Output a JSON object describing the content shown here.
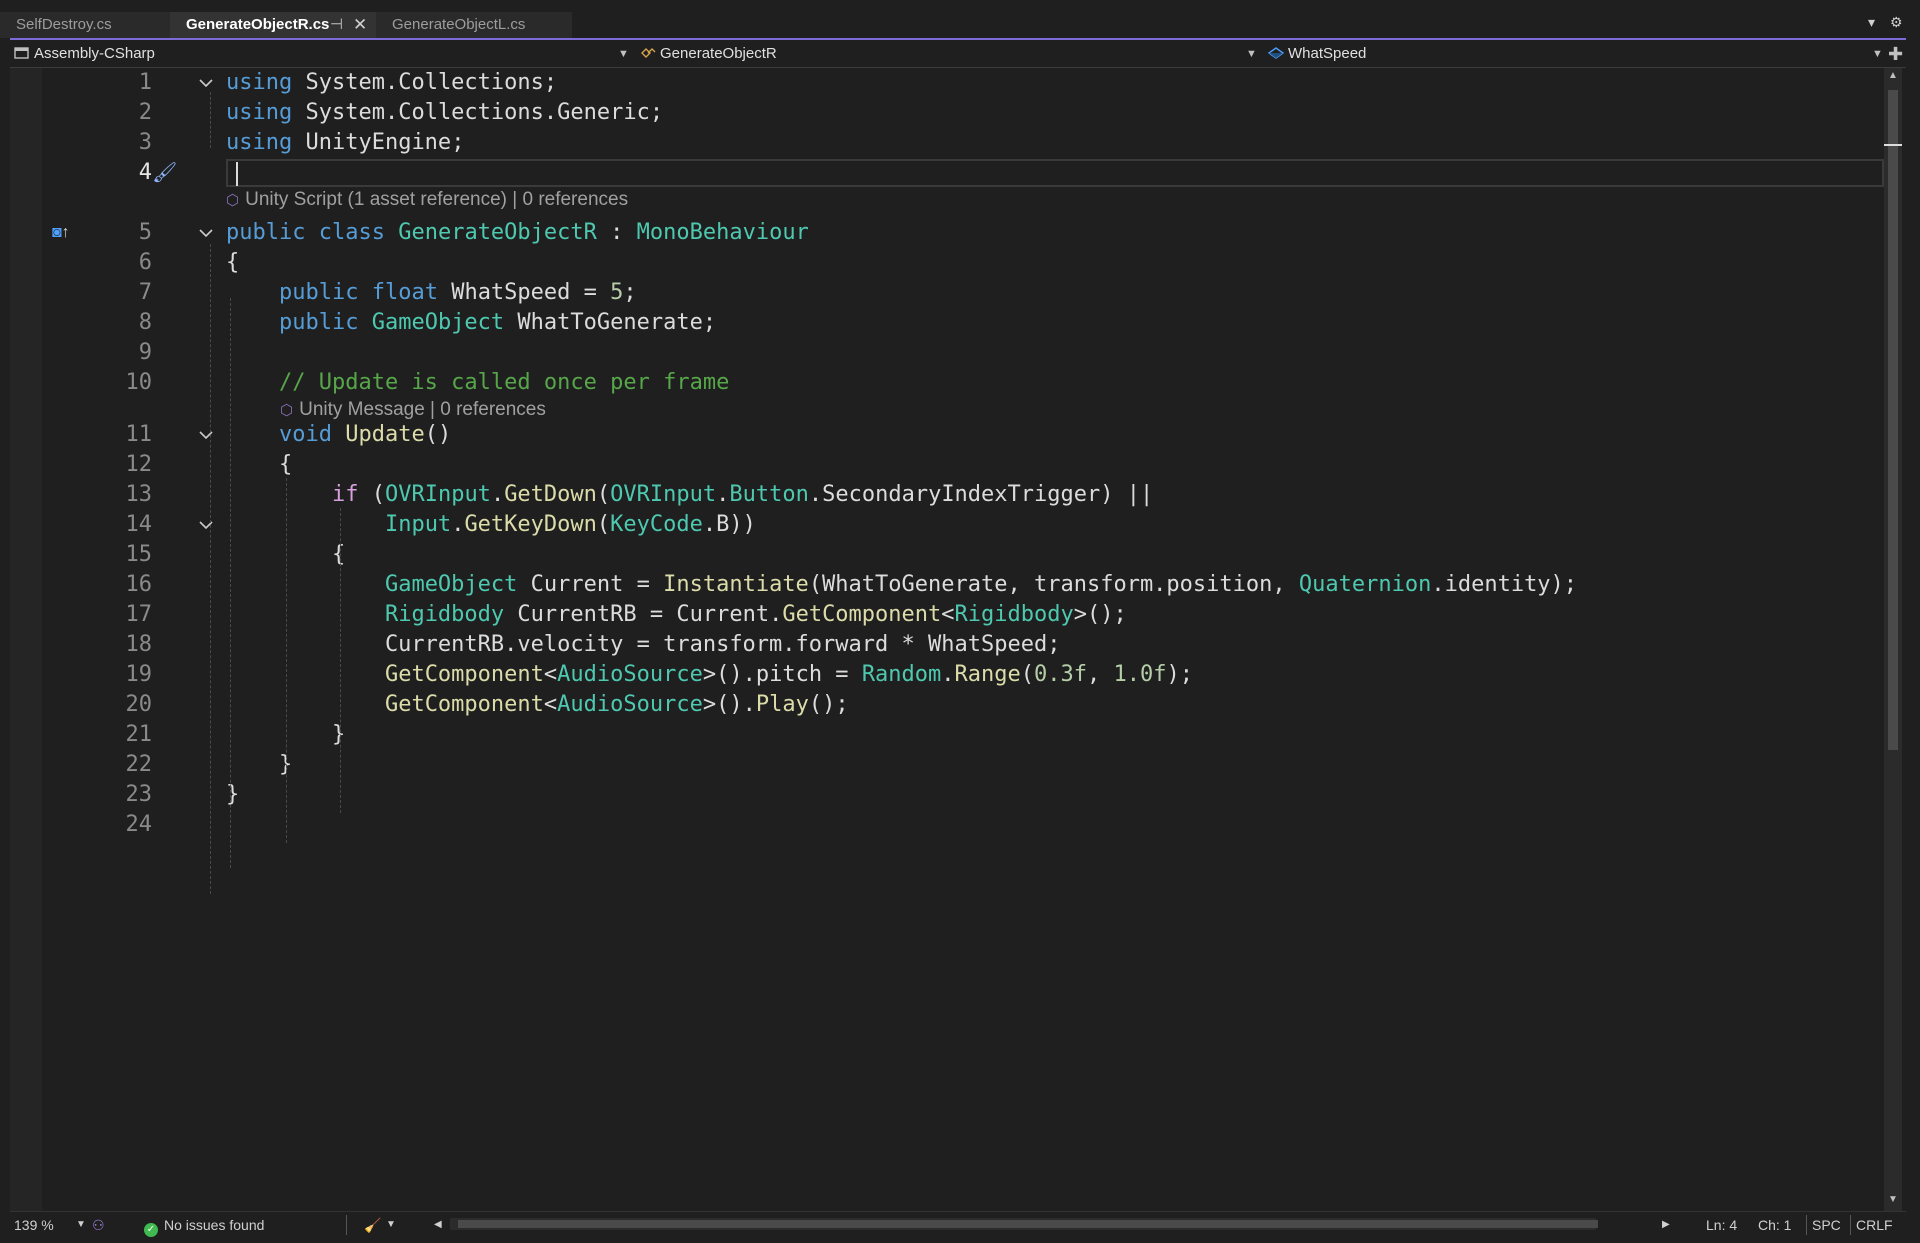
{
  "tabs": [
    {
      "label": "SelfDestroy.cs"
    },
    {
      "label": "GenerateObjectR.cs"
    },
    {
      "label": "GenerateObjectL.cs"
    }
  ],
  "tab_controls": {
    "overflow_icon": "chevron-down-icon",
    "settings_icon": "gear-icon"
  },
  "navbar": {
    "project": "Assembly-CSharp",
    "type": "GenerateObjectR",
    "member": "WhatSpeed"
  },
  "codelens": {
    "class_lens": "Unity Script (1 asset reference) | 0 references",
    "method_lens": "Unity Message | 0 references"
  },
  "line_numbers": [
    "1",
    "2",
    "3",
    "4",
    "5",
    "6",
    "7",
    "8",
    "9",
    "10",
    "11",
    "12",
    "13",
    "14",
    "15",
    "16",
    "17",
    "18",
    "19",
    "20",
    "21",
    "22",
    "23",
    "24"
  ],
  "code": [
    [
      [
        "using",
        "key"
      ],
      [
        " System",
        "id"
      ],
      [
        ".",
        "op"
      ],
      [
        "Collections",
        "id"
      ],
      [
        ";",
        "id"
      ]
    ],
    [
      [
        "using",
        "key"
      ],
      [
        " System",
        "id"
      ],
      [
        ".",
        "op"
      ],
      [
        "Collections",
        "id"
      ],
      [
        ".",
        "op"
      ],
      [
        "Generic",
        "id"
      ],
      [
        ";",
        "id"
      ]
    ],
    [
      [
        "using",
        "key"
      ],
      [
        " UnityEngine",
        "id"
      ],
      [
        ";",
        "id"
      ]
    ],
    [],
    [
      [
        "public",
        "key"
      ],
      [
        " ",
        "id"
      ],
      [
        "class",
        "key"
      ],
      [
        " ",
        "id"
      ],
      [
        "GenerateObjectR",
        "type"
      ],
      [
        " : ",
        "id"
      ],
      [
        "MonoBehaviour",
        "type"
      ]
    ],
    [
      [
        "{",
        "id"
      ]
    ],
    [
      [
        "    ",
        "id"
      ],
      [
        "public",
        "key"
      ],
      [
        " ",
        "id"
      ],
      [
        "float",
        "key"
      ],
      [
        " WhatSpeed = ",
        "id"
      ],
      [
        "5",
        "num"
      ],
      [
        ";",
        "id"
      ]
    ],
    [
      [
        "    ",
        "id"
      ],
      [
        "public",
        "key"
      ],
      [
        " ",
        "id"
      ],
      [
        "GameObject",
        "type"
      ],
      [
        " WhatToGenerate;",
        "id"
      ]
    ],
    [],
    [
      [
        "    ",
        "id"
      ],
      [
        "// Update is called once per frame",
        "cmt"
      ]
    ],
    [
      [
        "    ",
        "id"
      ],
      [
        "void",
        "key"
      ],
      [
        " ",
        "id"
      ],
      [
        "Update",
        "fn"
      ],
      [
        "()",
        "id"
      ]
    ],
    [
      [
        "    {",
        "id"
      ]
    ],
    [
      [
        "        ",
        "id"
      ],
      [
        "if",
        "ctl"
      ],
      [
        " (",
        "id"
      ],
      [
        "OVRInput",
        "type"
      ],
      [
        ".",
        "op"
      ],
      [
        "GetDown",
        "fn"
      ],
      [
        "(",
        "id"
      ],
      [
        "OVRInput",
        "type"
      ],
      [
        ".",
        "op"
      ],
      [
        "Button",
        "type"
      ],
      [
        ".",
        "op"
      ],
      [
        "SecondaryIndexTrigger) ||",
        "id"
      ]
    ],
    [
      [
        "            ",
        "id"
      ],
      [
        "Input",
        "type"
      ],
      [
        ".",
        "op"
      ],
      [
        "GetKeyDown",
        "fn"
      ],
      [
        "(",
        "id"
      ],
      [
        "KeyCode",
        "type"
      ],
      [
        ".",
        "op"
      ],
      [
        "B))",
        "id"
      ]
    ],
    [
      [
        "        {",
        "id"
      ]
    ],
    [
      [
        "            ",
        "id"
      ],
      [
        "GameObject",
        "type"
      ],
      [
        " Current = ",
        "id"
      ],
      [
        "Instantiate",
        "fn"
      ],
      [
        "(WhatToGenerate, transform.position, ",
        "id"
      ],
      [
        "Quaternion",
        "type"
      ],
      [
        ".",
        "op"
      ],
      [
        "identity);",
        "id"
      ]
    ],
    [
      [
        "            ",
        "id"
      ],
      [
        "Rigidbody",
        "type"
      ],
      [
        " CurrentRB = Current.",
        "id"
      ],
      [
        "GetComponent",
        "fn"
      ],
      [
        "<",
        "id"
      ],
      [
        "Rigidbody",
        "type"
      ],
      [
        ">();",
        "id"
      ]
    ],
    [
      [
        "            CurrentRB.velocity = transform.forward * WhatSpeed;",
        "id"
      ]
    ],
    [
      [
        "            ",
        "id"
      ],
      [
        "GetComponent",
        "fn"
      ],
      [
        "<",
        "id"
      ],
      [
        "AudioSource",
        "type"
      ],
      [
        ">().pitch = ",
        "id"
      ],
      [
        "Random",
        "type"
      ],
      [
        ".",
        "op"
      ],
      [
        "Range",
        "fn"
      ],
      [
        "(",
        "id"
      ],
      [
        "0.3f",
        "num"
      ],
      [
        ", ",
        "id"
      ],
      [
        "1.0f",
        "num"
      ],
      [
        ");",
        "id"
      ]
    ],
    [
      [
        "            ",
        "id"
      ],
      [
        "GetComponent",
        "fn"
      ],
      [
        "<",
        "id"
      ],
      [
        "AudioSource",
        "type"
      ],
      [
        ">().",
        "id"
      ],
      [
        "Play",
        "fn"
      ],
      [
        "();",
        "id"
      ]
    ],
    [
      [
        "        }",
        "id"
      ]
    ],
    [
      [
        "    }",
        "id"
      ]
    ],
    [
      [
        "}",
        "id"
      ]
    ],
    []
  ],
  "colors": {
    "key": "#569cd6",
    "ctl": "#d8a0df",
    "type": "#4ec9b0",
    "fn": "#dcdcaa",
    "num": "#b5cea8",
    "cmt": "#57a64a",
    "id": "#dcdcdc",
    "op": "#dcdcdc",
    "accent": "#7f6ad9",
    "ok": "#3fb950"
  },
  "status": {
    "zoom": "139 %",
    "issues": "No issues found",
    "line": "Ln: 4",
    "col": "Ch: 1",
    "indent": "SPC",
    "eol": "CRLF"
  }
}
